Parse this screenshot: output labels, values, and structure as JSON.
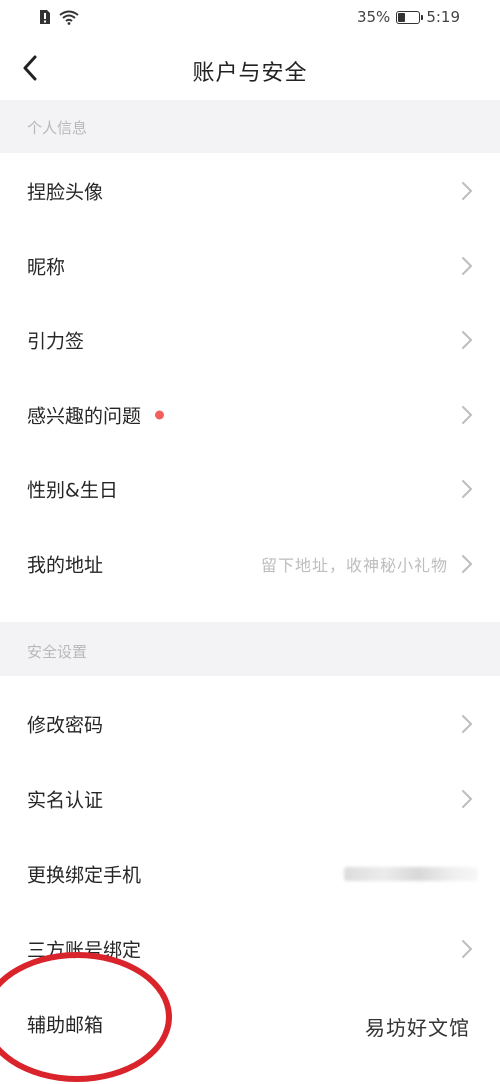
{
  "status_bar": {
    "battery_percent": "35%",
    "battery_level": 0.35,
    "time": "5:19",
    "icons": [
      "sim-alert-icon",
      "wifi-icon",
      "battery-icon"
    ]
  },
  "nav": {
    "title": "账户与安全",
    "back_icon": "chevron-left-icon"
  },
  "sections": [
    {
      "header": "个人信息",
      "rows": [
        {
          "label": "捏脸头像",
          "hint": "",
          "dot": false
        },
        {
          "label": "昵称",
          "hint": "",
          "dot": false
        },
        {
          "label": "引力签",
          "hint": "",
          "dot": false
        },
        {
          "label": "感兴趣的问题",
          "hint": "",
          "dot": true
        },
        {
          "label": "性别&生日",
          "hint": "",
          "dot": false
        },
        {
          "label": "我的地址",
          "hint": "留下地址，收神秘小礼物",
          "dot": false
        }
      ]
    },
    {
      "header": "安全设置",
      "rows": [
        {
          "label": "修改密码",
          "hint": "",
          "dot": false
        },
        {
          "label": "实名认证",
          "hint": "",
          "dot": false
        },
        {
          "label": "更换绑定手机",
          "hint": "",
          "dot": false
        },
        {
          "label": "三方账号绑定",
          "hint": "",
          "dot": false
        },
        {
          "label": "辅助邮箱",
          "hint": "",
          "dot": false
        }
      ]
    }
  ],
  "watermark": "易坊好文馆",
  "colors": {
    "section_bg": "#f3f3f5",
    "red_dot": "#f06060",
    "annotation_circle": "#d9242c"
  }
}
